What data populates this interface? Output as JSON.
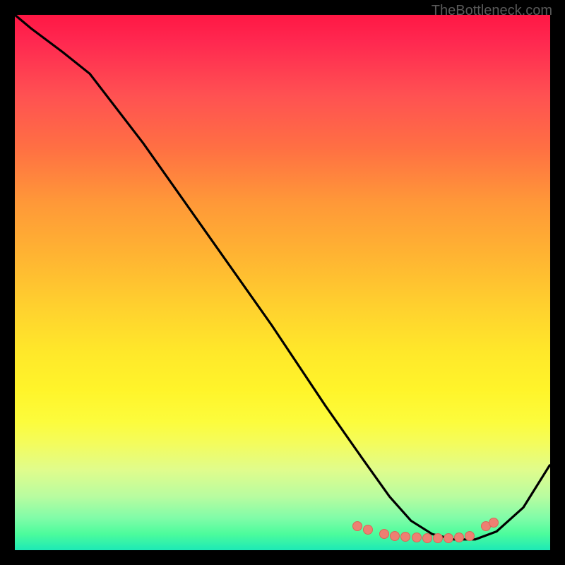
{
  "watermark": "TheBottleneck.com",
  "chart_data": {
    "type": "line",
    "title": "",
    "xlabel": "",
    "ylabel": "",
    "xlim": [
      0,
      100
    ],
    "ylim": [
      0,
      100
    ],
    "series": [
      {
        "name": "curve",
        "x": [
          0,
          3,
          9,
          14,
          24,
          36,
          48,
          58,
          65,
          70,
          74,
          78,
          82,
          86,
          90,
          95,
          100
        ],
        "y": [
          100,
          97.5,
          93,
          89,
          76,
          59,
          42,
          27,
          17,
          10,
          5.5,
          3,
          2,
          2,
          3.5,
          8,
          16
        ]
      }
    ],
    "markers": {
      "name": "highlight-points",
      "x": [
        64,
        66,
        69,
        71,
        73,
        75,
        77,
        79,
        81,
        83,
        85,
        88,
        89.5
      ],
      "y": [
        4.5,
        3.8,
        3.0,
        2.7,
        2.5,
        2.4,
        2.3,
        2.3,
        2.3,
        2.4,
        2.7,
        4.5,
        5.2
      ]
    }
  }
}
